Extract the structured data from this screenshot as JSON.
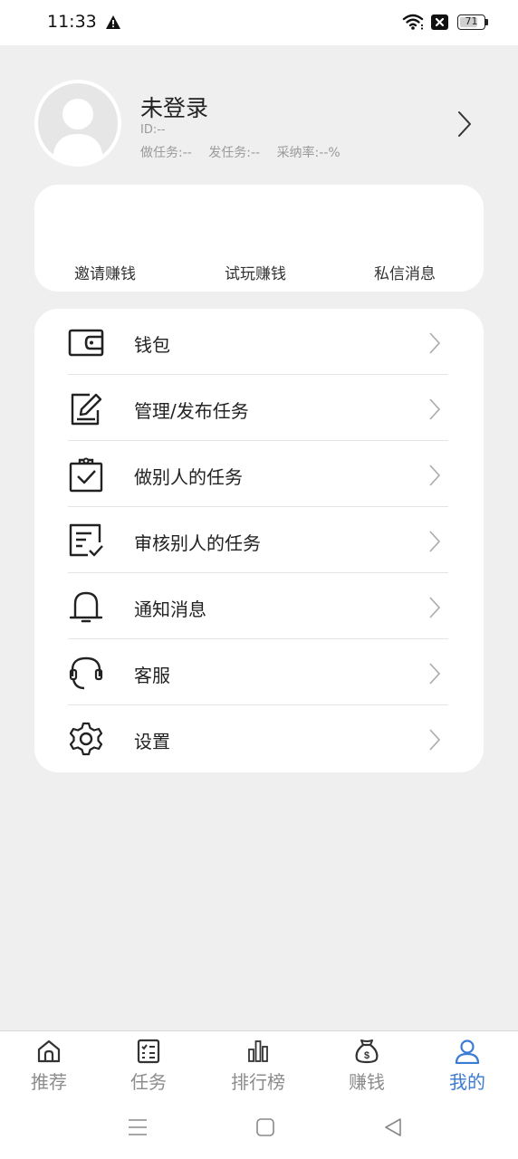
{
  "status_bar": {
    "time": "11:33",
    "battery": "71"
  },
  "profile": {
    "name": "未登录",
    "id": "ID:--",
    "stats": [
      "做任务:--",
      "发任务:--",
      "采纳率:--%"
    ]
  },
  "quick_actions": [
    "邀请赚钱",
    "试玩赚钱",
    "私信消息"
  ],
  "menu": [
    {
      "label": "钱包",
      "icon": "wallet-icon"
    },
    {
      "label": "管理/发布任务",
      "icon": "edit-icon"
    },
    {
      "label": "做别人的任务",
      "icon": "clipboard-check-icon"
    },
    {
      "label": "审核别人的任务",
      "icon": "review-icon"
    },
    {
      "label": "通知消息",
      "icon": "bell-icon"
    },
    {
      "label": "客服",
      "icon": "headset-icon"
    },
    {
      "label": "设置",
      "icon": "gear-icon"
    }
  ],
  "tabs": [
    {
      "label": "推荐",
      "icon": "home-icon",
      "active": false
    },
    {
      "label": "任务",
      "icon": "task-list-icon",
      "active": false
    },
    {
      "label": "排行榜",
      "icon": "bar-chart-icon",
      "active": false
    },
    {
      "label": "赚钱",
      "icon": "money-bag-icon",
      "active": false
    },
    {
      "label": "我的",
      "icon": "user-icon",
      "active": true
    }
  ],
  "colors": {
    "accent": "#3a7bd5",
    "background": "#efefef",
    "card": "#ffffff",
    "tab_inactive": "#8c8c8c"
  }
}
